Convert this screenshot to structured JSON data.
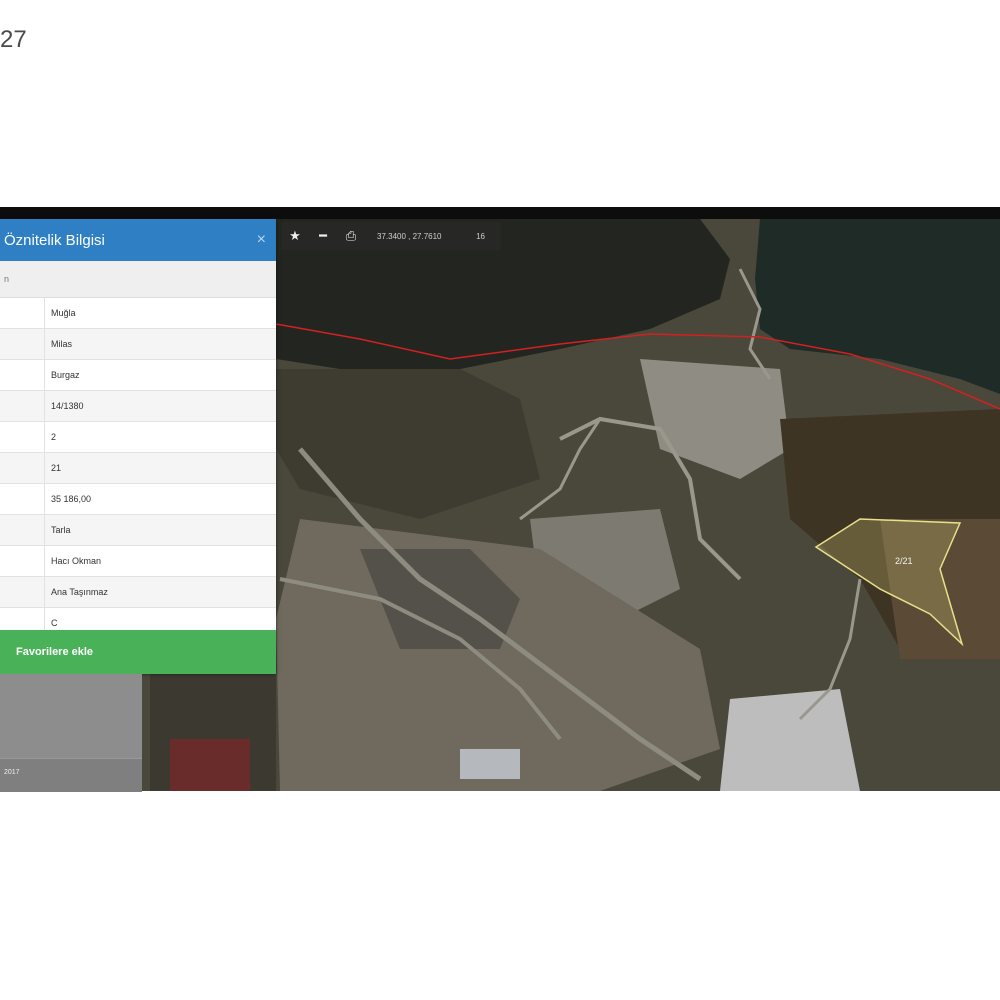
{
  "page_number": "27",
  "toolbar": {
    "icons": [
      "star-icon",
      "measure-icon",
      "print-icon"
    ],
    "coordinates": "37.3400 , 27.7610",
    "zoom": "16"
  },
  "panel": {
    "title": "Öznitelik Bilgisi",
    "close_label": "×",
    "subheader": "n",
    "rows": [
      {
        "value": "Muğla"
      },
      {
        "value": "Milas"
      },
      {
        "value": "Burgaz"
      },
      {
        "value": "14/1380"
      },
      {
        "value": "2"
      },
      {
        "value": "21"
      },
      {
        "value": "35 186,00"
      },
      {
        "value": "Tarla"
      },
      {
        "value": "Hacı Okman"
      },
      {
        "value": "Ana Taşınmaz"
      },
      {
        "value": "C"
      }
    ],
    "favorite_button": "Favorilere ekle"
  },
  "parcel_label": "2/21",
  "footer_text": "2017",
  "colors": {
    "header_blue": "#2f7fc4",
    "favorite_green": "#49b258",
    "parcel_outline": "#e8e08a",
    "boundary_red": "#d42020"
  }
}
